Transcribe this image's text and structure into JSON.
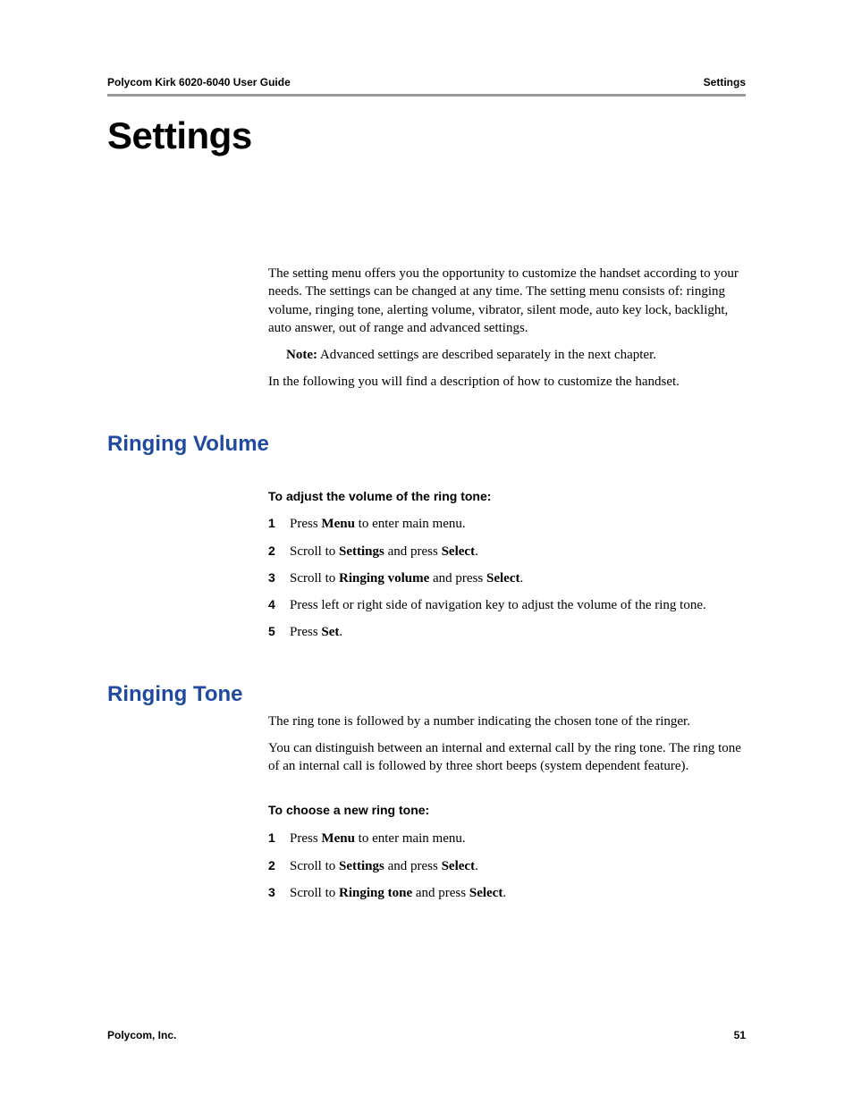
{
  "header": {
    "left": "Polycom Kirk 6020-6040 User Guide",
    "right": "Settings"
  },
  "title": "Settings",
  "intro": {
    "p1": "The setting menu offers you the opportunity to customize the handset according to your needs. The settings can be changed at any time. The setting menu consists of: ringing volume, ringing tone, alerting volume, vibrator, silent mode, auto key lock, backlight, auto answer, out of range and advanced settings.",
    "note_label": "Note:",
    "note_text": " Advanced settings are described separately in the next chapter.",
    "p2": "In the following you will find a description of how to customize the handset."
  },
  "section1": {
    "heading": "Ringing Volume",
    "subhead": "To adjust the volume of the ring tone:",
    "steps": {
      "s1a": "Press ",
      "s1b": "Menu",
      "s1c": " to enter main menu.",
      "s2a": "Scroll to ",
      "s2b": "Settings",
      "s2c": " and press ",
      "s2d": "Select",
      "s2e": ".",
      "s3a": "Scroll to ",
      "s3b": "Ringing volume",
      "s3c": "  and press ",
      "s3d": "Select",
      "s3e": ".",
      "s4": "Press left or right side of navigation key to adjust the volume of the ring tone.",
      "s5a": "Press ",
      "s5b": "Set",
      "s5c": "."
    }
  },
  "section2": {
    "heading": "Ringing Tone",
    "p1": "The ring tone is followed by a number indicating the chosen tone of the ringer.",
    "p2": "You can distinguish between an internal and external call by the ring tone. The ring tone of an internal call is followed by three short beeps (system dependent feature).",
    "subhead": "To choose a new ring tone:",
    "steps": {
      "s1a": "Press ",
      "s1b": "Menu",
      "s1c": " to enter main menu.",
      "s2a": "Scroll to ",
      "s2b": "Settings",
      "s2c": " and press ",
      "s2d": "Select",
      "s2e": ".",
      "s3a": "Scroll to ",
      "s3b": "Ringing tone",
      "s3c": " and press ",
      "s3d": "Select",
      "s3e": "."
    }
  },
  "footer": {
    "left": "Polycom, Inc.",
    "right": "51"
  }
}
